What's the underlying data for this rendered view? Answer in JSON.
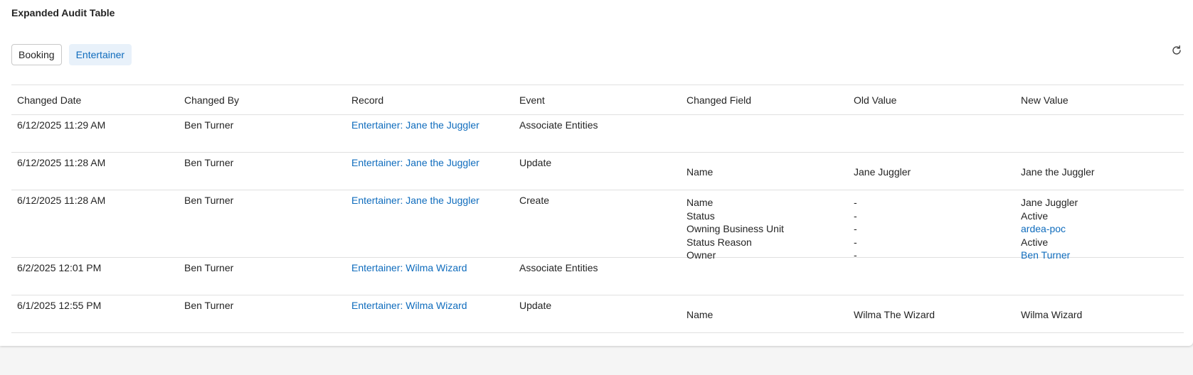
{
  "title": "Expanded Audit Table",
  "tabs": [
    {
      "label": "Booking",
      "active": false
    },
    {
      "label": "Entertainer",
      "active": true
    }
  ],
  "refresh_icon": "refresh-icon",
  "columns": [
    "Changed Date",
    "Changed By",
    "Record",
    "Event",
    "Changed Field",
    "Old Value",
    "New Value"
  ],
  "rows": [
    {
      "date": "6/12/2025 11:29 AM",
      "by": "Ben Turner",
      "record": "Entertainer: Jane the Juggler",
      "event": "Associate Entities",
      "changes": []
    },
    {
      "date": "6/12/2025 11:28 AM",
      "by": "Ben Turner",
      "record": "Entertainer: Jane the Juggler",
      "event": "Update",
      "changes": [
        {
          "field": "Name",
          "old": "Jane Juggler",
          "new": "Jane the Juggler"
        }
      ]
    },
    {
      "date": "6/12/2025 11:28 AM",
      "by": "Ben Turner",
      "record": "Entertainer: Jane the Juggler",
      "event": "Create",
      "changes": [
        {
          "field": "Name",
          "old": "-",
          "new": "Jane Juggler"
        },
        {
          "field": "Status",
          "old": "-",
          "new": "Active"
        },
        {
          "field": "Owning Business Unit",
          "old": "-",
          "new": "ardea-poc"
        },
        {
          "field": "Status Reason",
          "old": "-",
          "new": "Active"
        },
        {
          "field": "Owner",
          "old": "-",
          "new": "Ben Turner"
        }
      ]
    },
    {
      "date": "6/2/2025 12:01 PM",
      "by": "Ben Turner",
      "record": "Entertainer: Wilma Wizard",
      "event": "Associate Entities",
      "changes": []
    },
    {
      "date": "6/1/2025 12:55 PM",
      "by": "Ben Turner",
      "record": "Entertainer: Wilma Wizard",
      "event": "Update",
      "changes": [
        {
          "field": "Name",
          "old": "Wilma The Wizard",
          "new": "Wilma Wizard"
        }
      ]
    }
  ]
}
